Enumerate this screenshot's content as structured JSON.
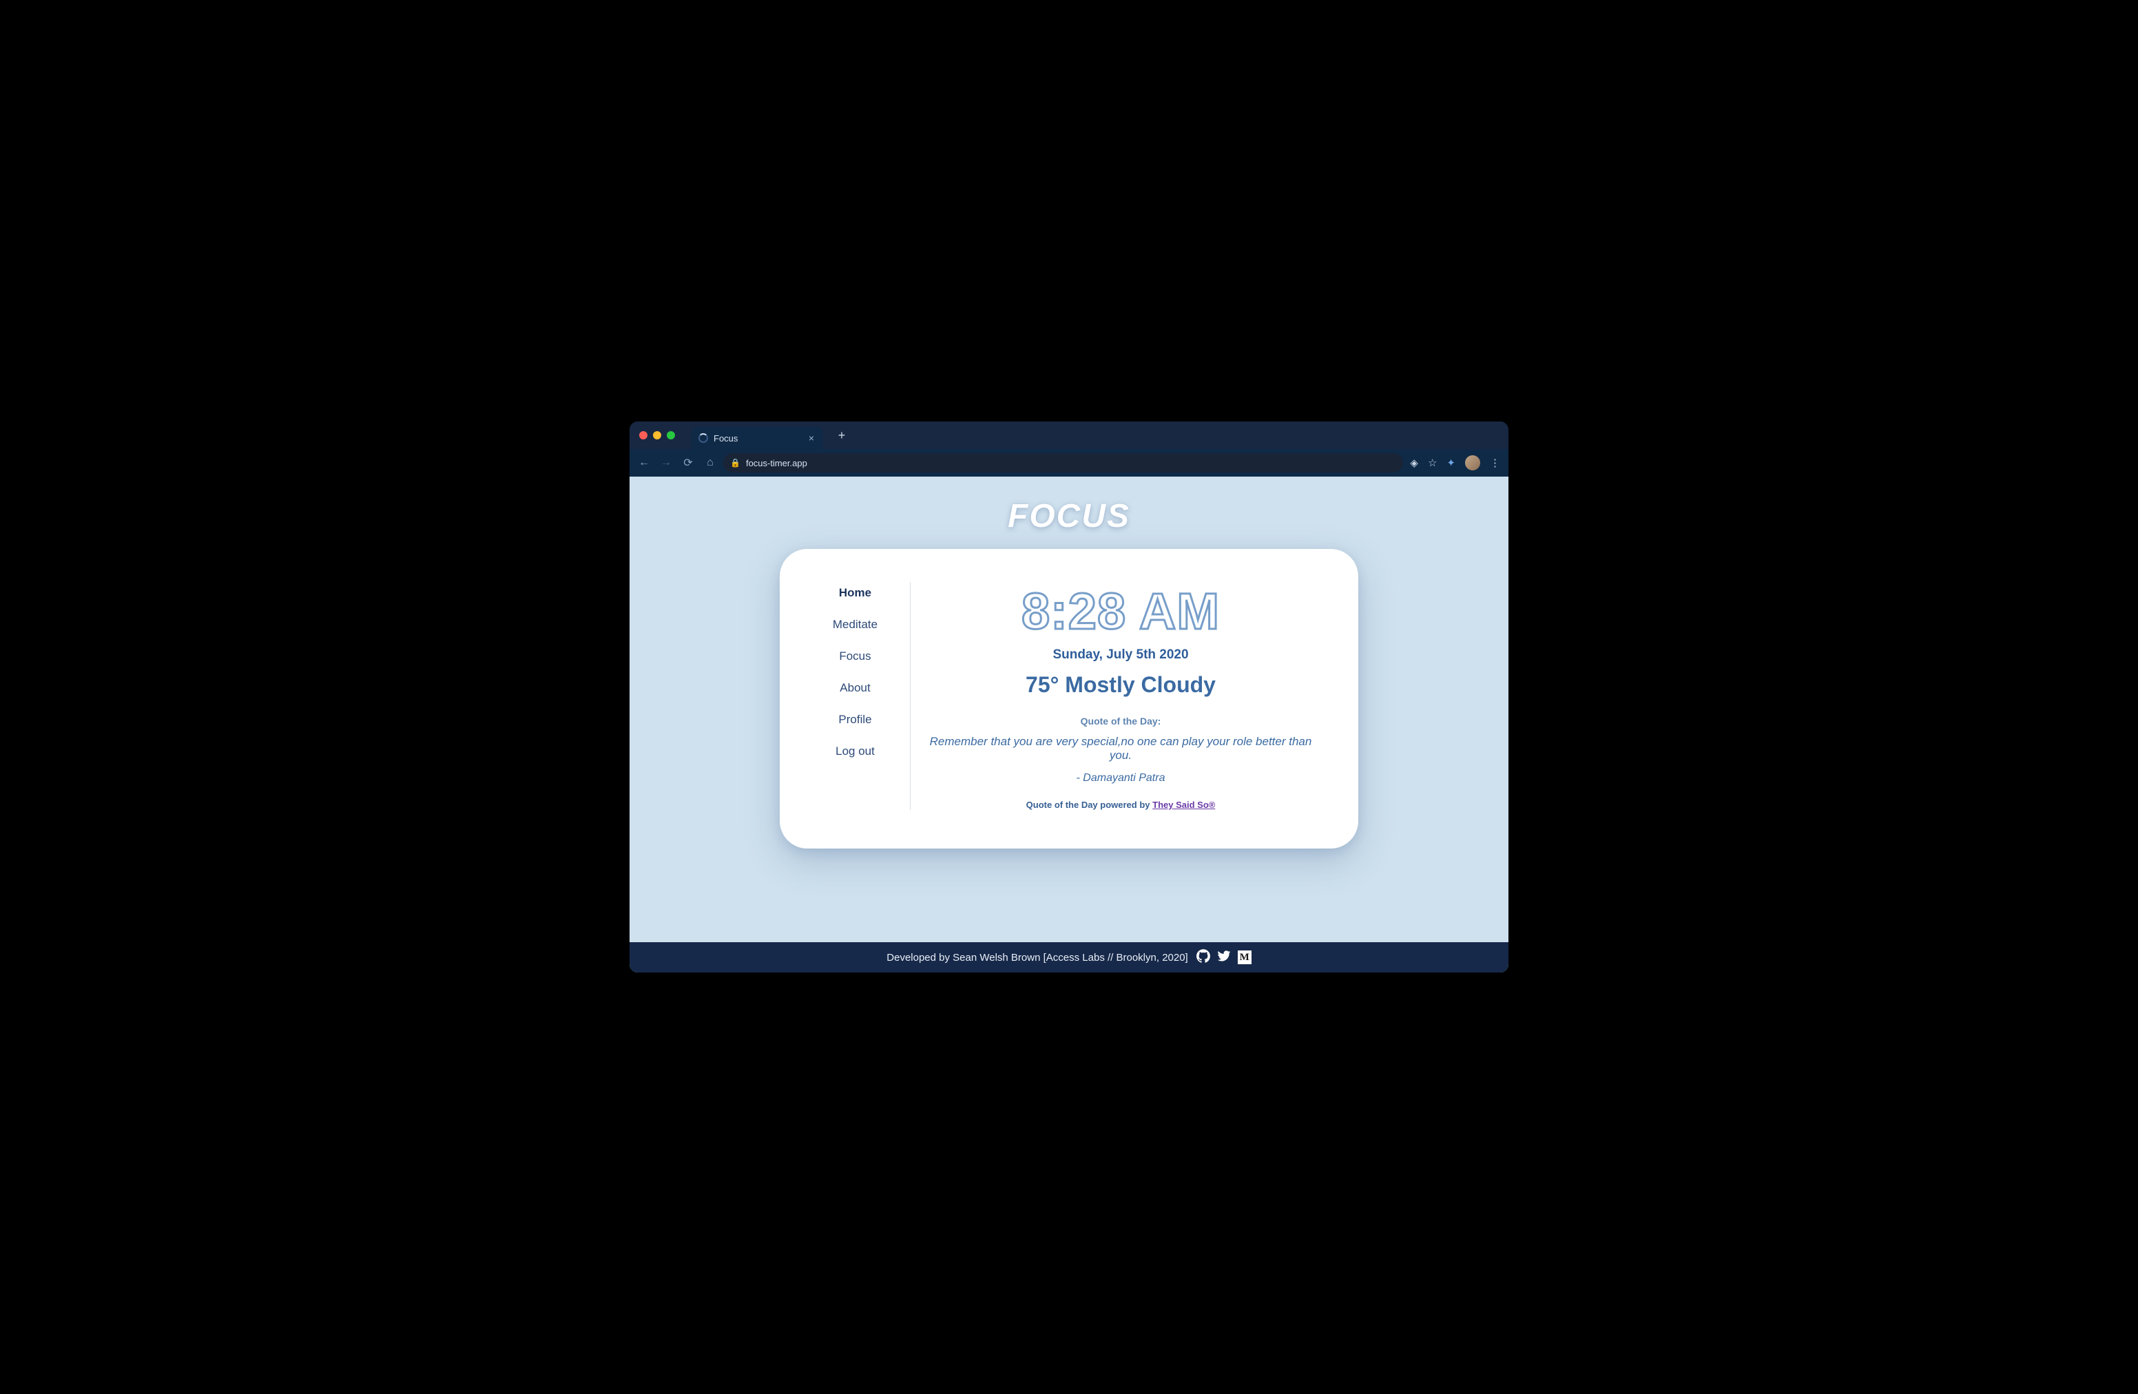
{
  "browser": {
    "tab_title": "Focus",
    "url": "focus-timer.app"
  },
  "app": {
    "title": "FOCUS"
  },
  "sidebar": {
    "items": [
      {
        "label": "Home",
        "active": true
      },
      {
        "label": "Meditate",
        "active": false
      },
      {
        "label": "Focus",
        "active": false
      },
      {
        "label": "About",
        "active": false
      },
      {
        "label": "Profile",
        "active": false
      },
      {
        "label": "Log out",
        "active": false
      }
    ]
  },
  "main": {
    "time": "8:28 AM",
    "date": "Sunday, July 5th 2020",
    "weather": "75° Mostly Cloudy",
    "quote_label": "Quote of the Day:",
    "quote_text": "Remember that you are very special,no one can play your role better than you.",
    "quote_author": "- Damayanti Patra",
    "powered_prefix": "Quote of the Day powered by ",
    "powered_link": "They Said So®"
  },
  "footer": {
    "text": "Developed by Sean Welsh Brown [Access Labs // Brooklyn, 2020]"
  }
}
